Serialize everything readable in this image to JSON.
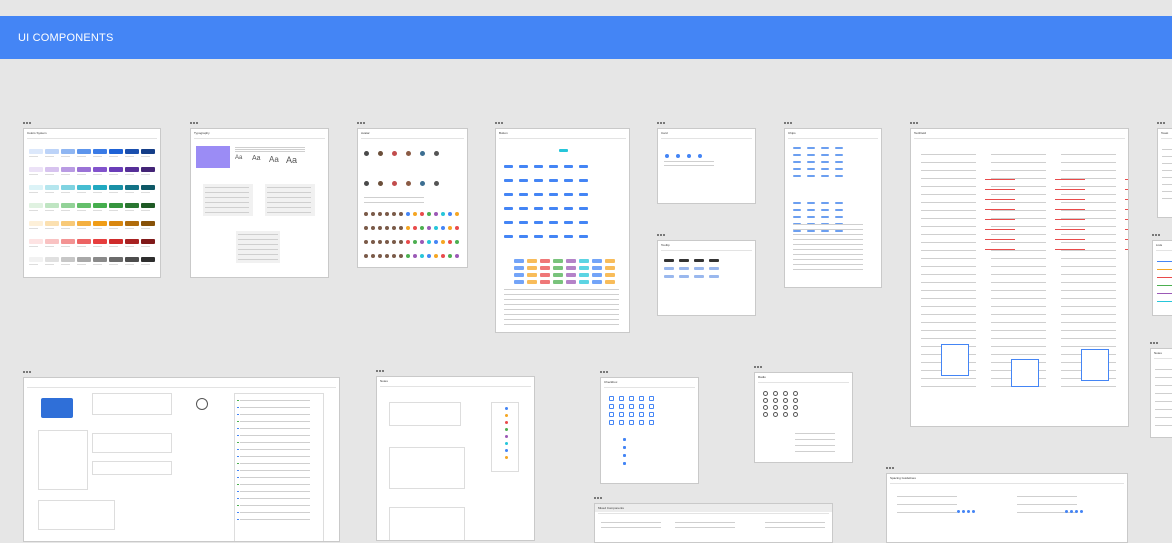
{
  "header": {
    "title": "UI COMPONENTS",
    "color": "#4485f5"
  },
  "frames": {
    "color_system": {
      "title": "Colors System"
    },
    "typography": {
      "title": "Typography",
      "banner_color": "#9b8cf5",
      "sample": "Aa"
    },
    "avatar": {
      "title": "Avatar"
    },
    "button": {
      "title": "Button"
    },
    "card": {
      "title": "Card"
    },
    "chips": {
      "title": "Chips"
    },
    "textfield": {
      "title": "TextField"
    },
    "tooltip": {
      "title": "Tooltip"
    },
    "toast": {
      "title": "Toast"
    },
    "lists": {
      "title": "Lists"
    },
    "misc": {
      "title": "",
      "card_color": "#2f6fd8"
    },
    "notes": {
      "title": "Notes"
    },
    "checkbox": {
      "title": "Checkbox"
    },
    "radio": {
      "title": "Radio"
    },
    "mixed_components": {
      "title": "Mixed Components"
    },
    "spacing_guidelines": {
      "title": "Spacing Guidelines"
    }
  },
  "palette": {
    "rows": [
      [
        "#dce8fb",
        "#bcd3f8",
        "#8fb6f2",
        "#5d95ec",
        "#3a7be6",
        "#1e62d6",
        "#1a4fae",
        "#153e88"
      ],
      [
        "#ece2f7",
        "#d7c3ef",
        "#b99be3",
        "#9a72d6",
        "#8253cc",
        "#6a3db8",
        "#562f98",
        "#432476"
      ],
      [
        "#dcf3f7",
        "#b5e6ee",
        "#7fd3e1",
        "#46bdd1",
        "#21a9c1",
        "#1990a6",
        "#137386",
        "#0e5866"
      ],
      [
        "#e0f2e1",
        "#bfe5c2",
        "#92d297",
        "#64bf6b",
        "#45ae4d",
        "#36953e",
        "#2a7731",
        "#1f5a25"
      ],
      [
        "#fdf0d9",
        "#fbe0b0",
        "#f8c977",
        "#f4b040",
        "#f09d17",
        "#d98710",
        "#b06c0c",
        "#875209"
      ],
      [
        "#fde3e3",
        "#f9c2c2",
        "#f39393",
        "#ec6363",
        "#e63e3e",
        "#cf2b2b",
        "#a82222",
        "#801a1a"
      ],
      [
        "#f2f2f2",
        "#e0e0e0",
        "#c7c7c7",
        "#a8a8a8",
        "#8a8a8a",
        "#6b6b6b",
        "#4d4d4d",
        "#2e2e2e"
      ]
    ]
  },
  "accent_colors": [
    "#4485f5",
    "#f5a623",
    "#e94b4b",
    "#4caf50",
    "#9b59b6",
    "#26c6da"
  ]
}
